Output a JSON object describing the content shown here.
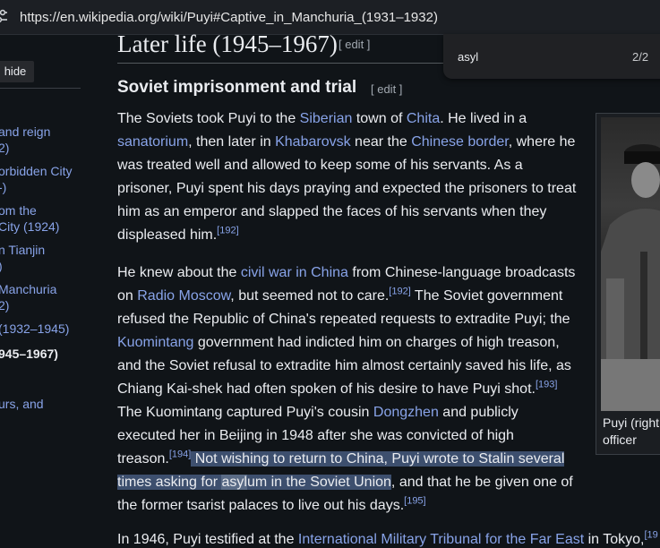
{
  "browser": {
    "url": "https://en.wikipedia.org/wiki/Puyi#Captive_in_Manchuria_(1931–1932)"
  },
  "find": {
    "query": "asyl",
    "count": "2/2"
  },
  "section": {
    "title": "Later life (1945–1967)",
    "edit": "[ edit ]"
  },
  "subsection": {
    "title": "Soviet imprisonment and trial",
    "edit": "[ edit ]"
  },
  "sidebar": {
    "hide_label": "hide",
    "items": [
      "and reign",
      "2)",
      "orbidden City",
      "-)",
      "om the",
      "City (1924)",
      "n Tianjin",
      ")",
      "Manchuria",
      "2)",
      "(1932–1945)",
      "945–1967)",
      "urs, and"
    ]
  },
  "figure": {
    "caption_line1": "Puyi (right",
    "caption_line2": "officer"
  },
  "p1": {
    "l1a": "The Soviets took Puyi to the ",
    "l1b": "Siberian",
    "l1c": " town of ",
    "l1d": "Chita",
    "l1e": ". He lived in a",
    "l2a": "sanatorium",
    "l2b": ", then later in ",
    "l2c": "Khabarovsk",
    "l2d": " near the ",
    "l2e": "Chinese border",
    "l2f": ", where he",
    "l3": "was treated well and allowed to keep some of his servants. As a",
    "l4": "prisoner, Puyi spent his days praying and expected the prisoners to treat",
    "l5": "him as an emperor and slapped the faces of his servants when they",
    "l6": "displeased him.",
    "ref": "[192]"
  },
  "p2": {
    "l1a": "He knew about the ",
    "l1b": "civil war in China",
    "l1c": " from Chinese-language broadcasts",
    "l2a": "on ",
    "l2b": "Radio Moscow",
    "l2c": ", but seemed not to care.",
    "l2ref": "[192]",
    "l2d": " The Soviet government",
    "l3": "refused the Republic of China's repeated requests to extradite Puyi; the",
    "l4a": "Kuomintang",
    "l4b": " government had indicted him on charges of high treason,",
    "l5": "and the Soviet refusal to extradite him almost certainly saved his life, as",
    "l6": "Chiang Kai-shek had often spoken of his desire to have Puyi shot.",
    "l6ref": "[193]",
    "l7a": "The Kuomintang captured Puyi's cousin ",
    "l7b": "Dongzhen",
    "l7c": " and publicly",
    "l8": "executed her in Beijing in 1948 after she was convicted of high",
    "l9a": "treason.",
    "l9ref": "[194]",
    "l9b": " Not wishing to return to China, Puyi wrote to Stalin several",
    "l10a": "times asking for ",
    "l10b": "asyl",
    "l10c": "um in the Soviet Union",
    "l10d": ", and that he be given one of",
    "l11": "the former tsarist palaces to live out his days.",
    "l11ref": "[195]"
  },
  "next": {
    "a": "In 1946, Puyi testified at the ",
    "b": "International Military Tribunal for the Far East",
    "c": " in Tokyo,",
    "ref": "[19"
  }
}
